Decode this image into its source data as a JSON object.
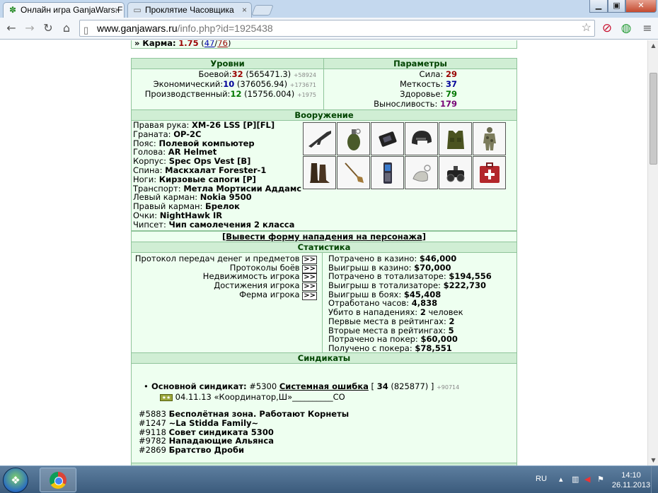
{
  "browser": {
    "tabs": [
      {
        "title": "Онлайн игра GanjaWars.F",
        "favicon": "ganja-leaf-icon",
        "active": true
      },
      {
        "title": "Проклятие Часовщика",
        "favicon": "page-icon",
        "active": false
      }
    ],
    "url_host": "www.ganjawars.ru",
    "url_path": "/info.php?id=1925438"
  },
  "karma": {
    "label": "» Карма:",
    "value": "1.75",
    "positive": "47",
    "negative": "76"
  },
  "levels": {
    "header": "Уровни",
    "rows": [
      {
        "label": "Боевой:",
        "level": "32",
        "exp": "(565471.3)",
        "delta": "+58924"
      },
      {
        "label": "Экономический:",
        "level": "10",
        "exp": "(376056.94)",
        "delta": "+173671"
      },
      {
        "label": "Производственный:",
        "level": "12",
        "exp": "(15756.004)",
        "delta": "+1975"
      }
    ]
  },
  "params": {
    "header": "Параметры",
    "rows": [
      {
        "label": "Сила:",
        "value": "29"
      },
      {
        "label": "Меткость:",
        "value": "37"
      },
      {
        "label": "Здоровье:",
        "value": "79"
      },
      {
        "label": "Выносливость:",
        "value": "179"
      }
    ]
  },
  "armament": {
    "header": "Вооружение",
    "rows": [
      {
        "label": "Правая рука:",
        "value": "XM-26 LSS [P][FL]"
      },
      {
        "label": "Граната:",
        "value": "OP-2C"
      },
      {
        "label": "Пояс:",
        "value": "Полевой компьютер"
      },
      {
        "label": "Голова:",
        "value": "AR Helmet"
      },
      {
        "label": "Корпус:",
        "value": "Spec Ops Vest [B]"
      },
      {
        "label": "Спина:",
        "value": "Маскхалат Forester-1"
      },
      {
        "label": "Ноги:",
        "value": "Кирзовые сапоги [P]"
      },
      {
        "label": "Транспорт:",
        "value": "Метла Мортисии Аддамс"
      },
      {
        "label": "Левый карман:",
        "value": "Nokia 9500"
      },
      {
        "label": "Правый карман:",
        "value": "Брелок"
      },
      {
        "label": "Очки:",
        "value": "NightHawk IR"
      },
      {
        "label": "Чипсет:",
        "value": "Чип самолечения 2 класса"
      }
    ],
    "item_icons": [
      "rifle-icon",
      "grenade-icon",
      "field-computer-icon",
      "helmet-icon",
      "vest-icon",
      "camouflage-suit-icon",
      "boots-icon",
      "broom-icon",
      "phone-icon",
      "keychain-icon",
      "night-vision-icon",
      "medkit-chip-icon"
    ],
    "attack_link": "[Вывести форму нападения на персонажа]"
  },
  "stats": {
    "header": "Статистика",
    "links": [
      {
        "label": "Протокол передач денег и предметов",
        "btn": ">>"
      },
      {
        "label": "Протоколы боёв",
        "btn": ">>"
      },
      {
        "label": "Недвижимость игрока",
        "btn": ">>"
      },
      {
        "label": "Достижения игрока",
        "btn": ">>"
      },
      {
        "label": "Ферма игрока",
        "btn": ">>"
      }
    ],
    "values": [
      {
        "label": "Потрачено в казино:",
        "value": "$46,000"
      },
      {
        "label": "Выигрыш в казино:",
        "value": "$70,000"
      },
      {
        "label": "Потрачено в тотализаторе:",
        "value": "$194,556"
      },
      {
        "label": "Выигрыш в тотализаторе:",
        "value": "$222,730"
      },
      {
        "label": "Выигрыш в боях:",
        "value": "$45,408"
      },
      {
        "label": "Отработано часов:",
        "value": "4,838"
      },
      {
        "label": "Убито в нападениях:",
        "value": "2",
        "suffix": "человек"
      },
      {
        "label": "Первые места в рейтингах:",
        "value": "2"
      },
      {
        "label": "Вторые места в рейтингах:",
        "value": "5"
      },
      {
        "label": "Потрачено на покер:",
        "value": "$60,000"
      },
      {
        "label": "Получено с покера:",
        "value": "$78,551"
      }
    ]
  },
  "syndicates": {
    "header": "Синдикаты",
    "main_label": "Основной синдикат:",
    "main_id": "#5300",
    "main_name": "Системная ошибка",
    "main_open": "[",
    "main_level": "34",
    "main_exp": "(825877)",
    "main_close": "]",
    "main_delta": "+90714",
    "sub_date": "04.11.13 «Координатор,Ш»__________CO",
    "list": [
      {
        "id": "#5883",
        "name": "Бесполётная зона. Работают Корнеты"
      },
      {
        "id": "#1247",
        "name": "~La Stidda Family~"
      },
      {
        "id": "#9118",
        "name": "Совет синдиката 5300"
      },
      {
        "id": "#9782",
        "name": "Нападающие Альянса"
      },
      {
        "id": "#2869",
        "name": "Братство Дроби"
      }
    ]
  },
  "taskbar": {
    "lang": "RU",
    "time": "14:10",
    "date": "26.11.2013"
  }
}
